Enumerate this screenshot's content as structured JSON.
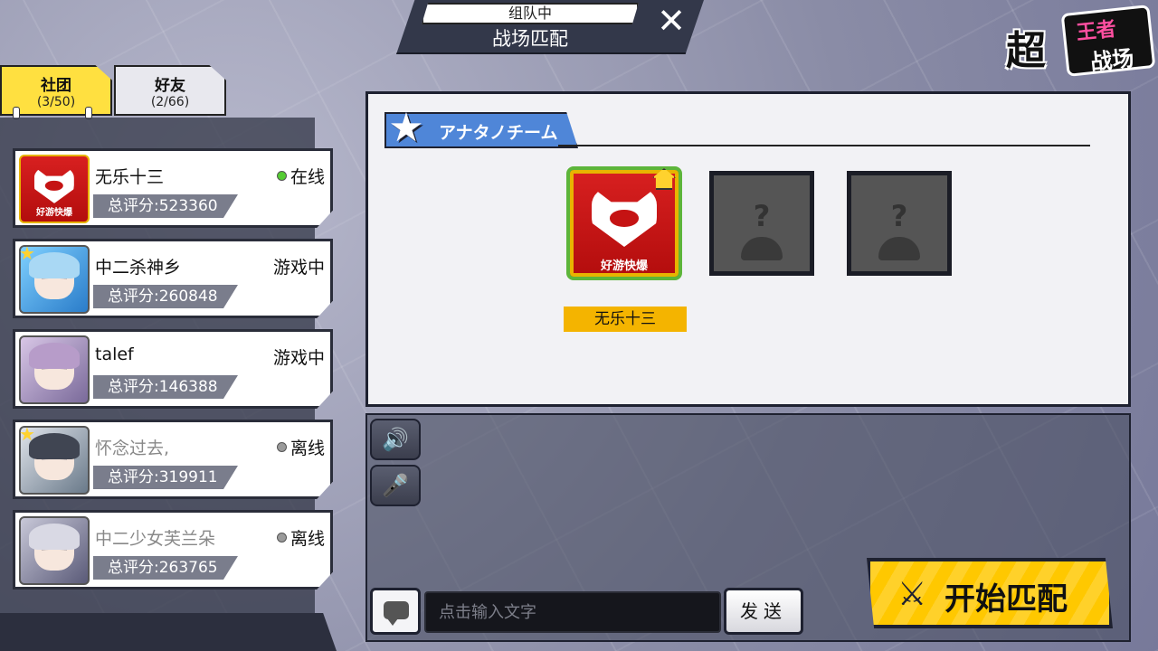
{
  "header": {
    "status": "组队中",
    "title": "战场匹配",
    "close_icon": "✕"
  },
  "logo": {
    "main": "超",
    "sub1": "王者",
    "sub2": "战场"
  },
  "tabs": [
    {
      "label": "社团",
      "count": "(3/50)",
      "active": true
    },
    {
      "label": "好友",
      "count": "(2/66)",
      "active": false
    }
  ],
  "members": [
    {
      "name": "无乐十三",
      "status": "在线",
      "online": true,
      "score": "总评分:523360",
      "avatar": "fox-mask",
      "avatar_label": "好游快爆"
    },
    {
      "name": "中二杀神乡",
      "status": "游戏中",
      "online": true,
      "score": "总评分:260848",
      "avatar": "blue-hair-glasses"
    },
    {
      "name": "talef",
      "status": "游戏中",
      "online": true,
      "score": "总评分:146388",
      "avatar": "purple-hair"
    },
    {
      "name": "怀念过去,",
      "status": "离线",
      "online": false,
      "score": "总评分:319911",
      "avatar": "masked-white"
    },
    {
      "name": "中二少女芙兰朵",
      "status": "离线",
      "online": false,
      "score": "总评分:263765",
      "avatar": "silver-hair"
    }
  ],
  "team": {
    "label": "アナタノチーム",
    "leader_name": "无乐十三",
    "leader_avatar_label": "好游快爆",
    "empty_slot_mark": "?"
  },
  "chat": {
    "placeholder": "点击输入文字",
    "send_label": "发送",
    "speaker_icon": "🔊",
    "mic_icon": "🎤"
  },
  "start_button": {
    "label": "开始匹配",
    "icon": "⚔"
  },
  "colors": {
    "accent_yellow": "#ffd12a",
    "online_green": "#55cc33",
    "offline_gray": "#9a9a9a",
    "team_blue": "#4f86d8"
  }
}
